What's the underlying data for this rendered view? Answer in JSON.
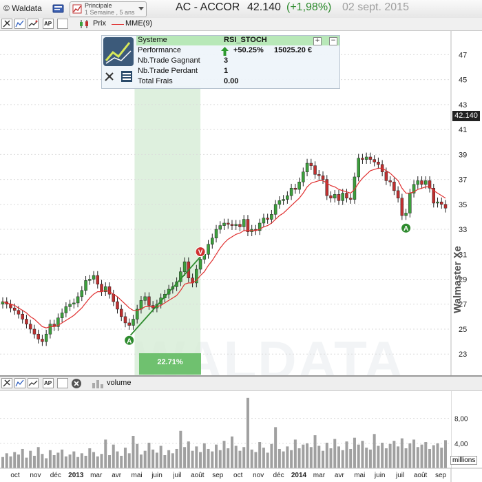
{
  "header": {
    "copyright": "© Waldata",
    "preset_title": "Principale",
    "preset_sub": "1 Semaine , 5 ans",
    "symbol": "AC - ACCOR",
    "price": "42.140",
    "change": "(+1,98%)",
    "date": "02 sept. 2015",
    "colors": {
      "price": "#222222",
      "change": "#2e8b2e",
      "date": "#a0a0a0"
    }
  },
  "toolbar": {
    "icons": [
      "cursor-icon",
      "line-chart-icon",
      "trend-icon",
      "ap-icon",
      "blank-icon"
    ],
    "legend_price": "Prix",
    "legend_ma": "MME(9)"
  },
  "system": {
    "header_label": "Systeme",
    "header_value": "RSI_STOCH",
    "rows": [
      {
        "label": "Performance",
        "value": "+50.25%",
        "value2": "15025.20 €"
      },
      {
        "label": "Nb.Trade Gagnant",
        "value": "3"
      },
      {
        "label": "Nb.Trade Perdant",
        "value": "1"
      },
      {
        "label": "Total Frais",
        "value": "0.00"
      }
    ],
    "plus": "+",
    "minus": "−"
  },
  "trade_pct": "22.71%",
  "last_price_tag": "42.140",
  "watermark_text": "Walmaster Xe",
  "watermark_big": "WALDATA",
  "volume_panel": {
    "label": "volume",
    "unit": "millions",
    "ticks": [
      "8,00",
      "4,00"
    ]
  },
  "colors": {
    "up": "#3ca03c",
    "down": "#c03030",
    "ma": "#e03030",
    "zone": "#d6ecd6",
    "trade_line": "#2e8b2e",
    "volume": "#a0a0a0"
  },
  "chart_data": {
    "type": "candlestick",
    "title": "AC - ACCOR",
    "interval": "1 Semaine",
    "y_ticks": [
      23,
      25,
      27,
      29,
      31,
      33,
      35,
      37,
      39,
      41,
      43,
      45,
      47
    ],
    "ylim": [
      21.3,
      48.9
    ],
    "x_labels": [
      "oct",
      "nov",
      "déc",
      "2013",
      "mar",
      "avr",
      "mai",
      "juin",
      "juil",
      "août",
      "sep",
      "oct",
      "nov",
      "déc",
      "2014",
      "mar",
      "avr",
      "mai",
      "juin",
      "juil",
      "août",
      "sep"
    ],
    "closes": [
      27.2,
      27.0,
      26.7,
      26.5,
      26.2,
      25.8,
      25.4,
      25.0,
      24.6,
      24.2,
      24.0,
      24.6,
      25.4,
      25.2,
      25.9,
      26.3,
      26.8,
      27.0,
      27.1,
      27.6,
      28.1,
      28.9,
      29.0,
      29.3,
      28.6,
      28.0,
      28.4,
      27.8,
      27.2,
      26.6,
      26.0,
      25.5,
      25.3,
      25.8,
      26.6,
      27.3,
      27.6,
      26.9,
      26.7,
      27.0,
      27.5,
      27.8,
      28.2,
      28.4,
      28.8,
      29.6,
      30.4,
      29.1,
      28.7,
      29.8,
      30.6,
      31.0,
      31.8,
      32.3,
      33.0,
      33.3,
      33.5,
      33.4,
      33.3,
      33.4,
      33.2,
      33.8,
      32.8,
      33.0,
      32.9,
      33.5,
      33.9,
      33.8,
      34.2,
      35.0,
      35.3,
      35.4,
      35.7,
      36.3,
      36.2,
      36.8,
      37.6,
      38.3,
      38.1,
      37.4,
      37.3,
      37.0,
      35.7,
      35.5,
      35.8,
      35.3,
      35.9,
      35.5,
      35.4,
      37.2,
      38.7,
      38.6,
      38.8,
      38.6,
      38.4,
      38.2,
      37.6,
      36.9,
      36.8,
      36.1,
      35.5,
      34.1,
      34.3,
      35.9,
      36.6,
      36.9,
      36.6,
      36.9,
      36.3,
      35.1,
      35.2,
      35.0,
      34.7
    ],
    "opens": [
      27.0,
      27.2,
      27.0,
      26.7,
      26.5,
      26.2,
      25.8,
      25.4,
      25.0,
      24.6,
      24.2,
      24.0,
      24.6,
      25.4,
      25.2,
      25.9,
      26.3,
      26.8,
      27.0,
      27.1,
      27.6,
      28.1,
      28.9,
      29.0,
      29.3,
      28.6,
      28.0,
      28.4,
      27.8,
      27.2,
      26.6,
      26.0,
      25.5,
      25.3,
      25.8,
      26.6,
      27.3,
      27.6,
      26.9,
      26.7,
      27.0,
      27.5,
      27.8,
      28.2,
      28.4,
      28.8,
      29.6,
      30.4,
      29.1,
      28.7,
      29.8,
      30.6,
      31.0,
      31.8,
      32.3,
      33.0,
      33.3,
      33.5,
      33.4,
      33.3,
      33.4,
      33.2,
      33.8,
      32.8,
      33.0,
      32.9,
      33.5,
      33.9,
      33.8,
      34.2,
      35.0,
      35.3,
      35.4,
      35.7,
      36.3,
      36.2,
      36.8,
      37.6,
      38.3,
      38.1,
      37.4,
      37.3,
      37.0,
      35.7,
      35.5,
      35.8,
      35.3,
      35.9,
      35.5,
      35.4,
      37.2,
      38.7,
      38.6,
      38.8,
      38.6,
      38.4,
      38.2,
      37.6,
      36.9,
      36.8,
      36.1,
      35.5,
      34.1,
      34.3,
      35.9,
      36.6,
      36.9,
      36.6,
      36.9,
      36.3,
      35.1,
      35.2,
      35.0
    ],
    "ma": [
      27.2,
      27.1,
      27.0,
      26.9,
      26.7,
      26.5,
      26.3,
      26.0,
      25.8,
      25.5,
      25.2,
      25.1,
      25.2,
      25.2,
      25.3,
      25.5,
      25.7,
      25.9,
      26.1,
      26.4,
      26.7,
      27.1,
      27.5,
      27.8,
      28.0,
      28.0,
      28.1,
      28.0,
      27.8,
      27.6,
      27.3,
      27.0,
      26.7,
      26.5,
      26.5,
      26.6,
      26.8,
      26.8,
      26.8,
      26.8,
      26.9,
      27.1,
      27.3,
      27.5,
      27.7,
      28.1,
      28.6,
      28.7,
      28.7,
      28.9,
      29.3,
      29.6,
      30.1,
      30.5,
      31.0,
      31.5,
      31.9,
      32.2,
      32.4,
      32.6,
      32.7,
      32.9,
      32.9,
      32.9,
      32.9,
      33.0,
      33.2,
      33.3,
      33.5,
      33.8,
      34.1,
      34.3,
      34.6,
      34.9,
      35.2,
      35.5,
      35.9,
      36.4,
      36.7,
      36.8,
      36.9,
      36.9,
      36.7,
      36.5,
      36.4,
      36.2,
      36.1,
      36.0,
      35.9,
      36.2,
      36.7,
      37.1,
      37.4,
      37.7,
      37.8,
      37.9,
      37.9,
      37.7,
      37.5,
      37.2,
      36.9,
      36.3,
      35.9,
      35.9,
      36.0,
      36.2,
      36.3,
      36.4,
      36.4,
      36.1,
      35.9,
      35.7,
      35.5
    ],
    "volumes": [
      1.8,
      2.4,
      1.9,
      2.6,
      2.2,
      3.1,
      1.7,
      2.8,
      2.0,
      3.4,
      2.3,
      1.6,
      2.9,
      2.1,
      2.5,
      3.0,
      1.9,
      2.2,
      2.7,
      1.8,
      2.4,
      2.0,
      3.2,
      2.6,
      1.9,
      2.3,
      4.6,
      2.1,
      3.8,
      2.7,
      2.0,
      3.3,
      2.4,
      5.2,
      3.9,
      2.2,
      2.8,
      4.1,
      3.0,
      2.5,
      3.6,
      2.1,
      2.9,
      2.4,
      3.1,
      6.0,
      3.4,
      4.3,
      2.8,
      3.5,
      2.6,
      4.0,
      3.1,
      2.7,
      3.8,
      2.9,
      4.4,
      3.2,
      5.1,
      3.6,
      2.8,
      3.4,
      11.3,
      3.0,
      2.6,
      4.2,
      3.3,
      2.5,
      3.9,
      6.6,
      3.1,
      2.7,
      3.5,
      2.9,
      4.6,
      3.2,
      3.8,
      4.0,
      3.4,
      5.3,
      3.6,
      2.8,
      4.1,
      3.2,
      4.7,
      3.5,
      2.9,
      4.3,
      3.1,
      4.9,
      3.8,
      4.4,
      3.3,
      3.0,
      5.5,
      3.6,
      4.1,
      3.2,
      3.9,
      4.4,
      3.5,
      4.8,
      3.2,
      4.0,
      4.6,
      3.4,
      3.8,
      4.2,
      3.1,
      3.7,
      4.0,
      3.3,
      4.5
    ],
    "trade_entry": {
      "label": "A",
      "price": 24.5
    },
    "trade_exit": {
      "label": "V",
      "price": 30.8
    },
    "trade_entry2": {
      "label": "A",
      "price": 33.4
    }
  }
}
